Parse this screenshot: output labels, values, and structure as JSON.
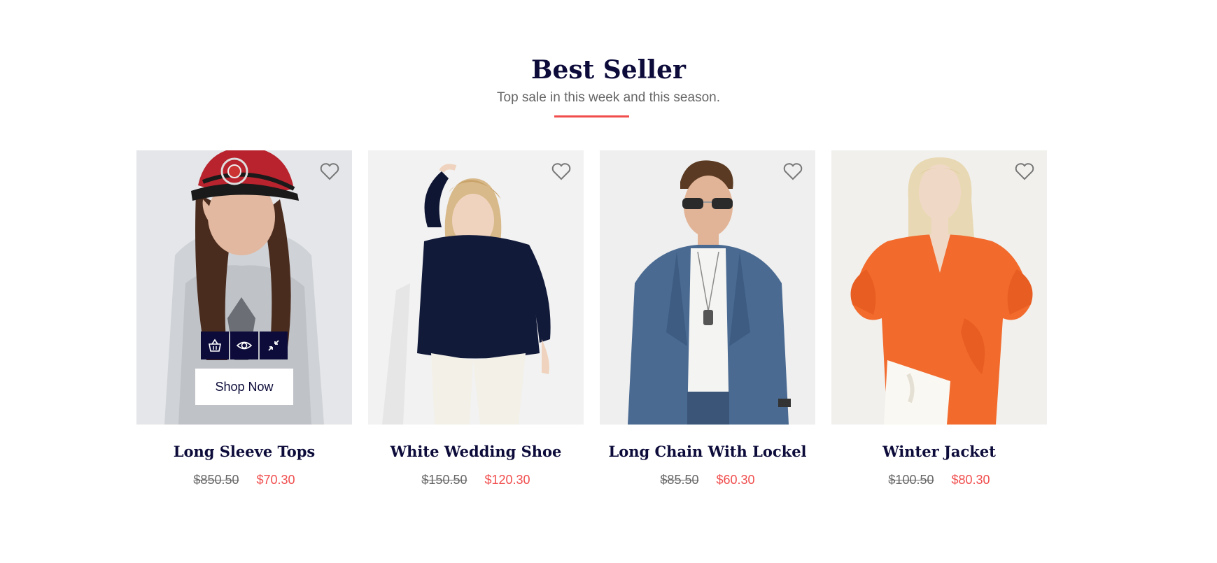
{
  "section": {
    "title": "Best Seller",
    "subtitle": "Top sale in this week and this season."
  },
  "colors": {
    "accent": "#f14d4d",
    "navy": "#0c0b3a",
    "muted": "#666666"
  },
  "products": [
    {
      "title": "Long Sleeve Tops",
      "old_price": "$850.50",
      "new_price": "$70.30",
      "shop_now_label": "Shop Now",
      "actions": [
        "basket-icon",
        "eye-icon",
        "compress-icon"
      ]
    },
    {
      "title": "White Wedding Shoe",
      "old_price": "$150.50",
      "new_price": "$120.30"
    },
    {
      "title": "Long Chain With Lockel",
      "old_price": "$85.50",
      "new_price": "$60.30"
    },
    {
      "title": "Winter Jacket",
      "old_price": "$100.50",
      "new_price": "$80.30"
    }
  ]
}
